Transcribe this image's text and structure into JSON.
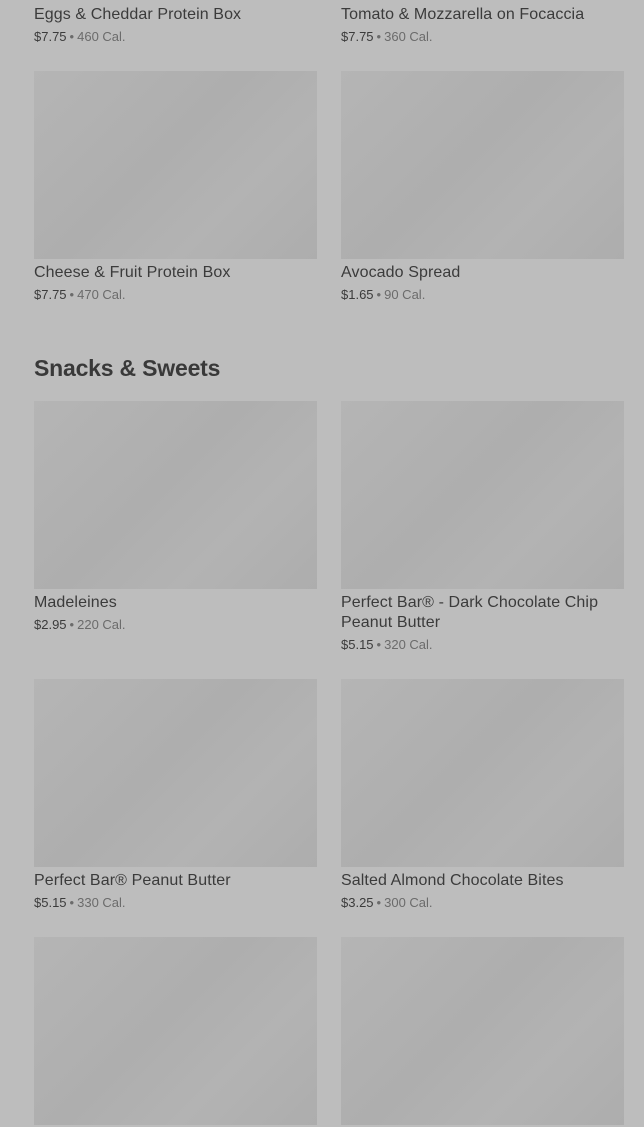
{
  "items_top": [
    {
      "name": "Eggs & Cheddar Protein Box",
      "price": "$7.75",
      "separator": "•",
      "calories": "460 Cal."
    },
    {
      "name": "Tomato & Mozzarella on Focaccia",
      "price": "$7.75",
      "separator": "•",
      "calories": "360 Cal."
    },
    {
      "name": "Cheese & Fruit Protein Box",
      "price": "$7.75",
      "separator": "•",
      "calories": "470 Cal."
    },
    {
      "name": "Avocado Spread",
      "price": "$1.65",
      "separator": "•",
      "calories": "90 Cal."
    }
  ],
  "section": {
    "title": "Snacks & Sweets"
  },
  "snacks": [
    {
      "name": "Madeleines",
      "price": "$2.95",
      "separator": "•",
      "calories": "220 Cal."
    },
    {
      "name": "Perfect Bar® - Dark Chocolate Chip Peanut Butter",
      "price": "$5.15",
      "separator": "•",
      "calories": "320 Cal."
    },
    {
      "name": "Perfect Bar® Peanut Butter",
      "price": "$5.15",
      "separator": "•",
      "calories": "330 Cal."
    },
    {
      "name": "Salted Almond Chocolate Bites",
      "price": "$3.25",
      "separator": "•",
      "calories": "300 Cal."
    }
  ]
}
